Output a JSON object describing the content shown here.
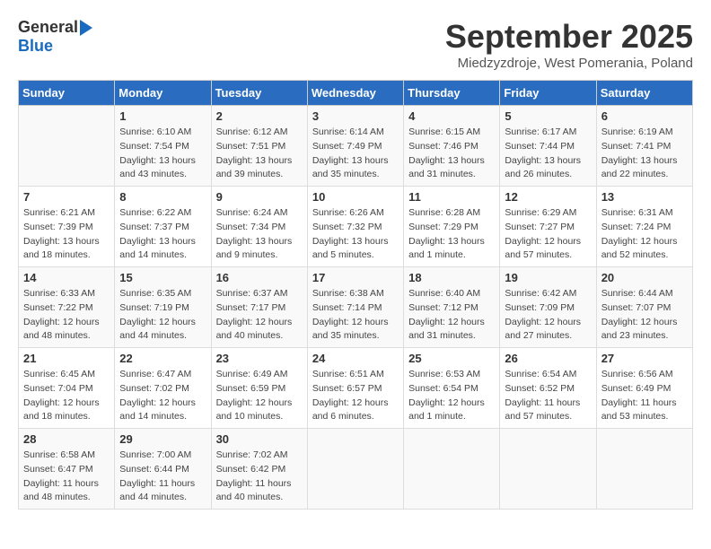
{
  "header": {
    "logo_general": "General",
    "logo_blue": "Blue",
    "month_title": "September 2025",
    "location": "Miedzyzdroje, West Pomerania, Poland"
  },
  "weekdays": [
    "Sunday",
    "Monday",
    "Tuesday",
    "Wednesday",
    "Thursday",
    "Friday",
    "Saturday"
  ],
  "weeks": [
    [
      {
        "day": "",
        "info": ""
      },
      {
        "day": "1",
        "info": "Sunrise: 6:10 AM\nSunset: 7:54 PM\nDaylight: 13 hours\nand 43 minutes."
      },
      {
        "day": "2",
        "info": "Sunrise: 6:12 AM\nSunset: 7:51 PM\nDaylight: 13 hours\nand 39 minutes."
      },
      {
        "day": "3",
        "info": "Sunrise: 6:14 AM\nSunset: 7:49 PM\nDaylight: 13 hours\nand 35 minutes."
      },
      {
        "day": "4",
        "info": "Sunrise: 6:15 AM\nSunset: 7:46 PM\nDaylight: 13 hours\nand 31 minutes."
      },
      {
        "day": "5",
        "info": "Sunrise: 6:17 AM\nSunset: 7:44 PM\nDaylight: 13 hours\nand 26 minutes."
      },
      {
        "day": "6",
        "info": "Sunrise: 6:19 AM\nSunset: 7:41 PM\nDaylight: 13 hours\nand 22 minutes."
      }
    ],
    [
      {
        "day": "7",
        "info": "Sunrise: 6:21 AM\nSunset: 7:39 PM\nDaylight: 13 hours\nand 18 minutes."
      },
      {
        "day": "8",
        "info": "Sunrise: 6:22 AM\nSunset: 7:37 PM\nDaylight: 13 hours\nand 14 minutes."
      },
      {
        "day": "9",
        "info": "Sunrise: 6:24 AM\nSunset: 7:34 PM\nDaylight: 13 hours\nand 9 minutes."
      },
      {
        "day": "10",
        "info": "Sunrise: 6:26 AM\nSunset: 7:32 PM\nDaylight: 13 hours\nand 5 minutes."
      },
      {
        "day": "11",
        "info": "Sunrise: 6:28 AM\nSunset: 7:29 PM\nDaylight: 13 hours\nand 1 minute."
      },
      {
        "day": "12",
        "info": "Sunrise: 6:29 AM\nSunset: 7:27 PM\nDaylight: 12 hours\nand 57 minutes."
      },
      {
        "day": "13",
        "info": "Sunrise: 6:31 AM\nSunset: 7:24 PM\nDaylight: 12 hours\nand 52 minutes."
      }
    ],
    [
      {
        "day": "14",
        "info": "Sunrise: 6:33 AM\nSunset: 7:22 PM\nDaylight: 12 hours\nand 48 minutes."
      },
      {
        "day": "15",
        "info": "Sunrise: 6:35 AM\nSunset: 7:19 PM\nDaylight: 12 hours\nand 44 minutes."
      },
      {
        "day": "16",
        "info": "Sunrise: 6:37 AM\nSunset: 7:17 PM\nDaylight: 12 hours\nand 40 minutes."
      },
      {
        "day": "17",
        "info": "Sunrise: 6:38 AM\nSunset: 7:14 PM\nDaylight: 12 hours\nand 35 minutes."
      },
      {
        "day": "18",
        "info": "Sunrise: 6:40 AM\nSunset: 7:12 PM\nDaylight: 12 hours\nand 31 minutes."
      },
      {
        "day": "19",
        "info": "Sunrise: 6:42 AM\nSunset: 7:09 PM\nDaylight: 12 hours\nand 27 minutes."
      },
      {
        "day": "20",
        "info": "Sunrise: 6:44 AM\nSunset: 7:07 PM\nDaylight: 12 hours\nand 23 minutes."
      }
    ],
    [
      {
        "day": "21",
        "info": "Sunrise: 6:45 AM\nSunset: 7:04 PM\nDaylight: 12 hours\nand 18 minutes."
      },
      {
        "day": "22",
        "info": "Sunrise: 6:47 AM\nSunset: 7:02 PM\nDaylight: 12 hours\nand 14 minutes."
      },
      {
        "day": "23",
        "info": "Sunrise: 6:49 AM\nSunset: 6:59 PM\nDaylight: 12 hours\nand 10 minutes."
      },
      {
        "day": "24",
        "info": "Sunrise: 6:51 AM\nSunset: 6:57 PM\nDaylight: 12 hours\nand 6 minutes."
      },
      {
        "day": "25",
        "info": "Sunrise: 6:53 AM\nSunset: 6:54 PM\nDaylight: 12 hours\nand 1 minute."
      },
      {
        "day": "26",
        "info": "Sunrise: 6:54 AM\nSunset: 6:52 PM\nDaylight: 11 hours\nand 57 minutes."
      },
      {
        "day": "27",
        "info": "Sunrise: 6:56 AM\nSunset: 6:49 PM\nDaylight: 11 hours\nand 53 minutes."
      }
    ],
    [
      {
        "day": "28",
        "info": "Sunrise: 6:58 AM\nSunset: 6:47 PM\nDaylight: 11 hours\nand 48 minutes."
      },
      {
        "day": "29",
        "info": "Sunrise: 7:00 AM\nSunset: 6:44 PM\nDaylight: 11 hours\nand 44 minutes."
      },
      {
        "day": "30",
        "info": "Sunrise: 7:02 AM\nSunset: 6:42 PM\nDaylight: 11 hours\nand 40 minutes."
      },
      {
        "day": "",
        "info": ""
      },
      {
        "day": "",
        "info": ""
      },
      {
        "day": "",
        "info": ""
      },
      {
        "day": "",
        "info": ""
      }
    ]
  ]
}
